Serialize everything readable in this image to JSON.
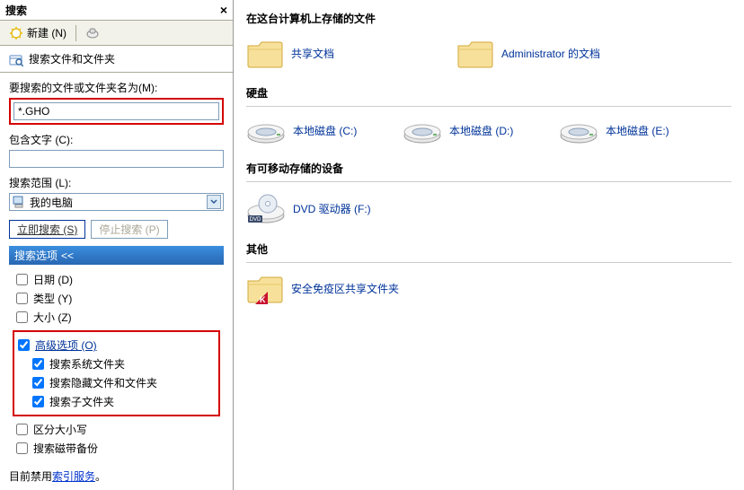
{
  "left": {
    "title": "搜索",
    "new_label": "新建 (N)",
    "companions_label": "搜索文件和文件夹",
    "filename_label": "要搜索的文件或文件夹名为(M):",
    "filename_value": "*.GHO",
    "contains_label": "包含文字 (C):",
    "contains_value": "",
    "scope_label": "搜索范围 (L):",
    "scope_value": "我的电脑",
    "search_now": "立即搜索 (S)",
    "stop_search": "停止搜索 (P)",
    "options_header": "搜索选项",
    "opt_date": "日期 (D)",
    "opt_type": "类型 (Y)",
    "opt_size": "大小 (Z)",
    "opt_adv": "高级选项 (O)",
    "opt_sys": "搜索系统文件夹",
    "opt_hidden": "搜索隐藏文件和文件夹",
    "opt_sub": "搜索子文件夹",
    "opt_case": "区分大小写",
    "opt_tape": "搜索磁带备份",
    "index_prefix": "目前禁用",
    "index_link": "索引服务",
    "index_suffix": "。"
  },
  "right": {
    "section_files": "在这台计算机上存储的文件",
    "shared_docs": "共享文档",
    "admin_docs": "Administrator 的文档",
    "section_disks": "硬盘",
    "disk_c": "本地磁盘 (C:)",
    "disk_d": "本地磁盘 (D:)",
    "disk_e": "本地磁盘 (E:)",
    "section_removable": "有可移动存储的设备",
    "dvd": "DVD 驱动器 (F:)",
    "dvd_badge": "DVD",
    "section_other": "其他",
    "secure_folder": "安全免疫区共享文件夹"
  }
}
